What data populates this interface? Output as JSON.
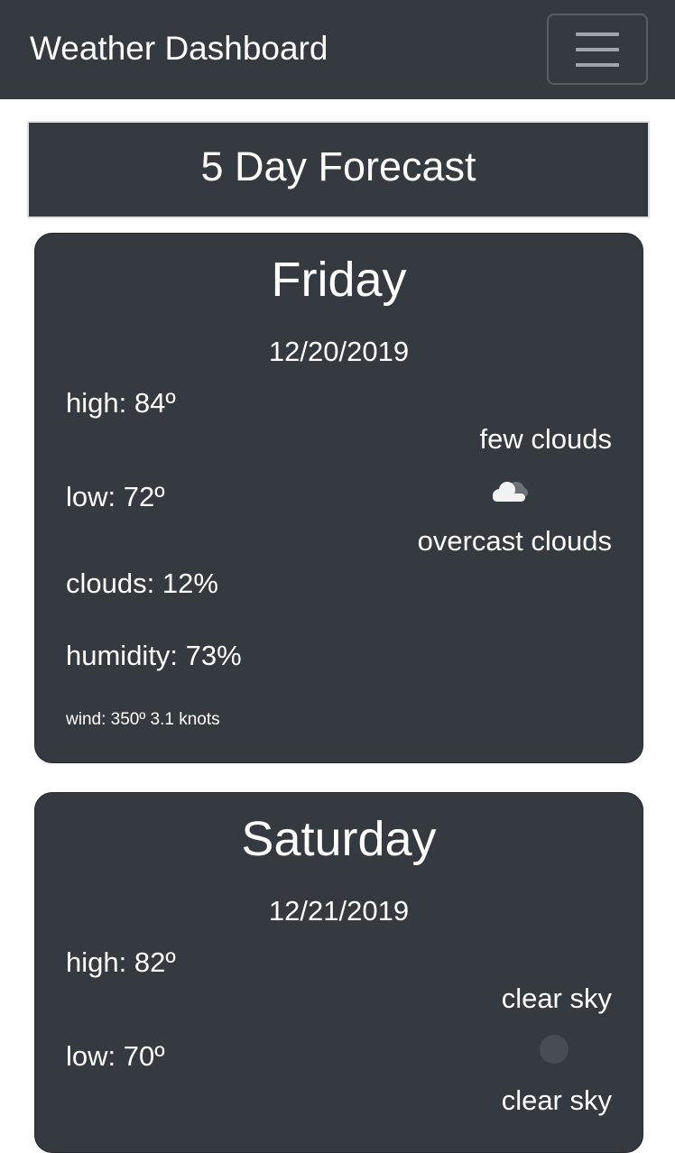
{
  "navbar": {
    "brand": "Weather Dashboard",
    "toggler_icon": "hamburger-menu-icon"
  },
  "forecast": {
    "title": "5 Day Forecast",
    "days": [
      {
        "day": "Friday",
        "date": "12/20/2019",
        "high": "high: 84º",
        "low": "low: 72º",
        "clouds": "clouds: 12%",
        "humidity": "humidity: 73%",
        "wind": "wind: 350º 3.1 knots",
        "description_top": "few clouds",
        "description_bottom": "overcast clouds",
        "icon": "cloud-icon"
      },
      {
        "day": "Saturday",
        "date": "12/21/2019",
        "high": "high: 82º",
        "low": "low: 70º",
        "description_top": "clear sky",
        "description_bottom": "clear sky",
        "icon": "clear-sky-icon"
      }
    ]
  }
}
